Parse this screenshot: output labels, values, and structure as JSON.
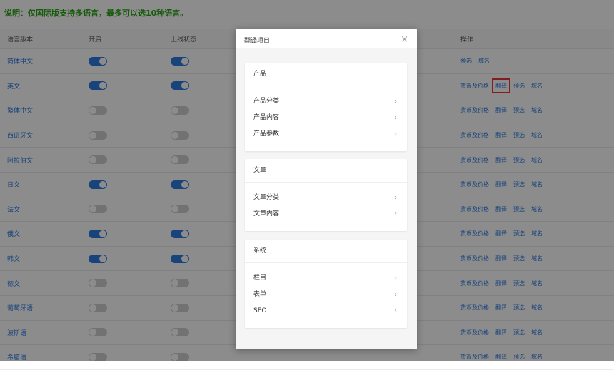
{
  "note": "说明：仅国际版支持多语言，最多可以选10种语言。",
  "table": {
    "headers": {
      "lang": "语言版本",
      "open": "开启",
      "online": "上线状态",
      "ops": "操作"
    },
    "rows": [
      {
        "lang": "简体中文",
        "open": true,
        "online": true,
        "ops": [
          "预选",
          "域名"
        ]
      },
      {
        "lang": "英文",
        "open": true,
        "online": true,
        "ops": [
          "货币及价格",
          "翻译",
          "预选",
          "域名"
        ],
        "highlight": "翻译"
      },
      {
        "lang": "繁体中文",
        "open": false,
        "online": false,
        "ops": [
          "货币及价格",
          "翻译",
          "预选",
          "域名"
        ]
      },
      {
        "lang": "西班牙文",
        "open": false,
        "online": false,
        "ops": [
          "货币及价格",
          "翻译",
          "预选",
          "域名"
        ]
      },
      {
        "lang": "阿拉伯文",
        "open": false,
        "online": false,
        "ops": [
          "货币及价格",
          "翻译",
          "预选",
          "域名"
        ]
      },
      {
        "lang": "日文",
        "open": true,
        "online": true,
        "ops": [
          "货币及价格",
          "翻译",
          "预选",
          "域名"
        ]
      },
      {
        "lang": "法文",
        "open": false,
        "online": false,
        "ops": [
          "货币及价格",
          "翻译",
          "预选",
          "域名"
        ]
      },
      {
        "lang": "俄文",
        "open": true,
        "online": true,
        "ops": [
          "货币及价格",
          "翻译",
          "预选",
          "域名"
        ]
      },
      {
        "lang": "韩文",
        "open": true,
        "online": true,
        "ops": [
          "货币及价格",
          "翻译",
          "预选",
          "域名"
        ]
      },
      {
        "lang": "德文",
        "open": false,
        "online": false,
        "ops": [
          "货币及价格",
          "翻译",
          "预选",
          "域名"
        ]
      },
      {
        "lang": "葡萄牙语",
        "open": false,
        "online": false,
        "ops": [
          "货币及价格",
          "翻译",
          "预选",
          "域名"
        ]
      },
      {
        "lang": "波斯语",
        "open": false,
        "online": false,
        "ops": [
          "货币及价格",
          "翻译",
          "预选",
          "域名"
        ]
      },
      {
        "lang": "希腊语",
        "open": false,
        "online": false,
        "ops": [
          "货币及价格",
          "翻译",
          "预选",
          "域名"
        ]
      }
    ]
  },
  "modal": {
    "title": "翻译项目",
    "close": "×",
    "sections": [
      {
        "title": "产品",
        "items": [
          "产品分类",
          "产品内容",
          "产品参数"
        ]
      },
      {
        "title": "文章",
        "items": [
          "文章分类",
          "文章内容"
        ]
      },
      {
        "title": "系统",
        "items": [
          "栏目",
          "表单",
          "SEO"
        ]
      }
    ]
  },
  "icons": {
    "chevron": "›"
  },
  "colors": {
    "accent": "#2d7be0",
    "note": "#2aa515",
    "highlight": "#e33333"
  }
}
